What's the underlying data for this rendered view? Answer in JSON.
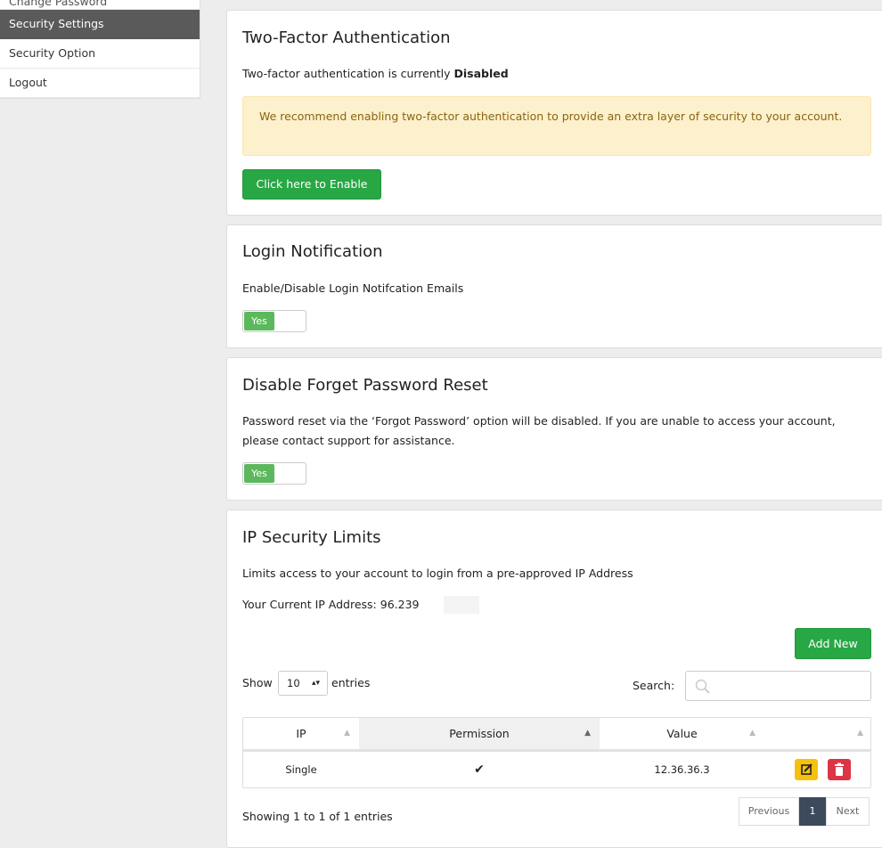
{
  "sidebar": {
    "items": [
      {
        "label": "Change Password"
      },
      {
        "label": "Security Settings"
      },
      {
        "label": "Security Option"
      },
      {
        "label": "Logout"
      }
    ]
  },
  "two_factor": {
    "title": "Two-Factor Authentication",
    "status_prefix": "Two-factor authentication is currently ",
    "status_value": "Disabled",
    "alert_text": "We recommend enabling two-factor authentication to provide an extra layer of security to your account.",
    "enable_button": "Click here to Enable"
  },
  "login_notification": {
    "title": "Login Notification",
    "description": "Enable/Disable Login Notifcation Emails",
    "toggle_label": "Yes"
  },
  "forget_password": {
    "title": "Disable Forget Password Reset",
    "description": "Password reset via the ‘Forgot Password’ option will be disabled. If you are unable to access your account, please contact support for assistance.",
    "toggle_label": "Yes"
  },
  "ip_limits": {
    "title": "IP Security Limits",
    "description": "Limits access to your account to login from a pre-approved IP Address",
    "current_ip_label": "Your Current IP Address: 96.239",
    "add_button": "Add New",
    "show_label": "Show",
    "entries_label": "entries",
    "page_size": "10",
    "search_label": "Search:",
    "columns": [
      "IP",
      "Permission",
      "Value"
    ],
    "rows": [
      {
        "ip": "Single",
        "permission": "✔",
        "value": "12.36.36.3"
      }
    ],
    "info": "Showing 1 to 1 of 1 entries",
    "pager": {
      "previous": "Previous",
      "current": "1",
      "next": "Next"
    }
  },
  "colors": {
    "accent_green": "#28a745",
    "active_sidebar": "#5a5a5a",
    "alert_bg": "#fdf0cd",
    "edit_yellow": "#f4c20d",
    "delete_red": "#dc3545"
  }
}
